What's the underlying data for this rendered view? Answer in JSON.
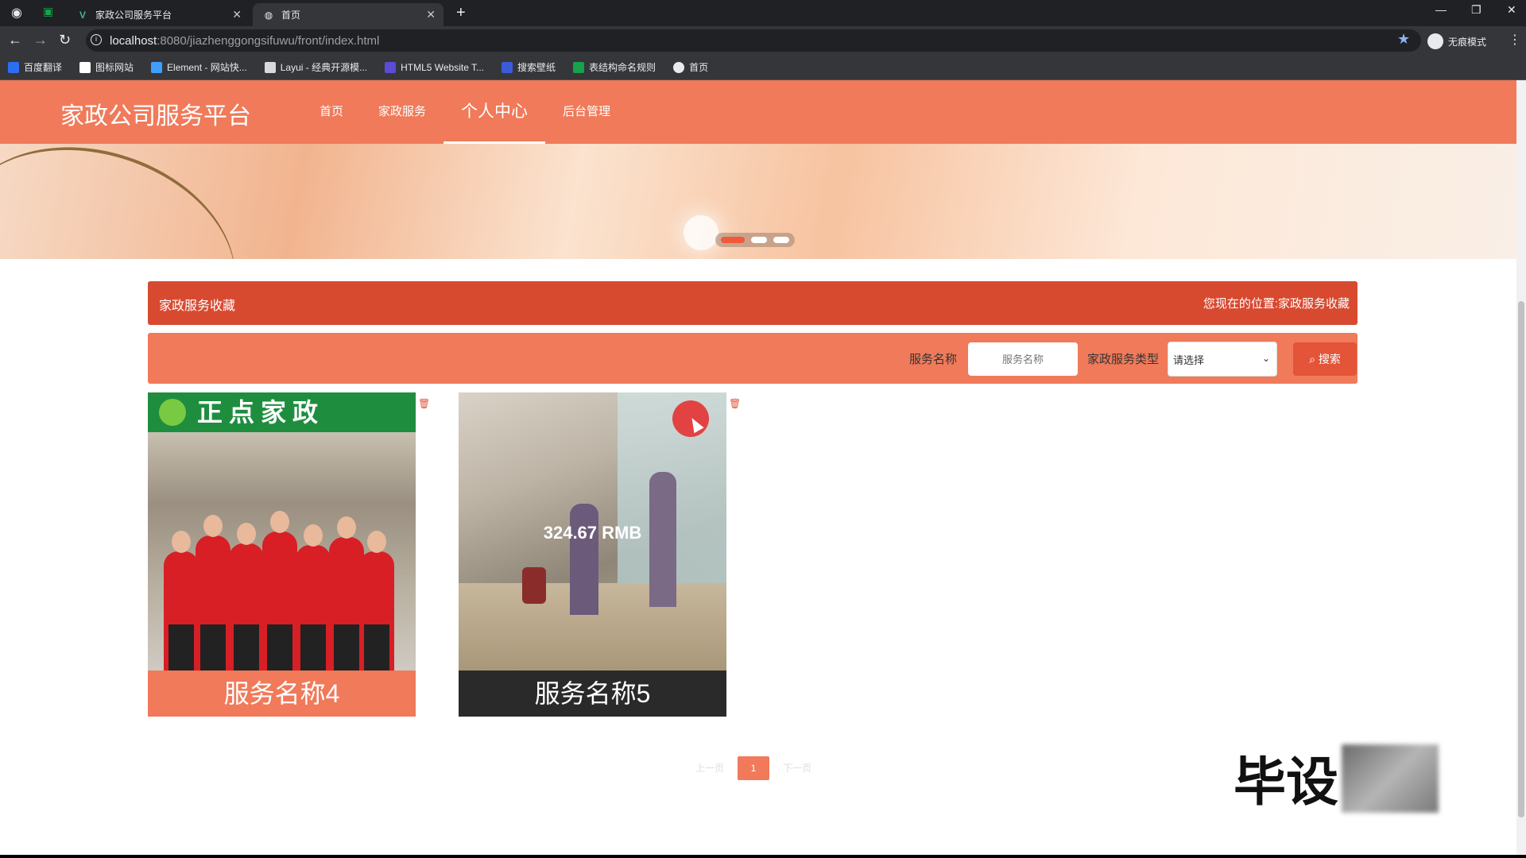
{
  "browser": {
    "tabs": [
      {
        "title": "家政公司服务平台",
        "active": false
      },
      {
        "title": "首页",
        "active": true
      }
    ],
    "new_tab": "+",
    "url_host": "localhost",
    "url_path": ":8080/jiazhenggongsifuwu/front/index.html",
    "profile_label": "无痕模式",
    "bookmarks": [
      {
        "label": "百度翻译",
        "color": "#2c6ef2"
      },
      {
        "label": "图标网站",
        "color": "#ffffff"
      },
      {
        "label": "Element - 网站快...",
        "color": "#409eff"
      },
      {
        "label": "Layui - 经典开源模...",
        "color": "#d9d9d9"
      },
      {
        "label": "HTML5 Website T...",
        "color": "#5b4bd6"
      },
      {
        "label": "搜索壁纸",
        "color": "#3b5bdb"
      },
      {
        "label": "表结构命名规则",
        "color": "#16a34a"
      },
      {
        "label": "首页",
        "color": "#e8eaed"
      }
    ]
  },
  "site": {
    "brand": "家政公司服务平台",
    "nav": [
      {
        "label": "首页",
        "active": false
      },
      {
        "label": "家政服务",
        "active": false
      },
      {
        "label": "个人中心",
        "active": true
      },
      {
        "label": "后台管理",
        "active": false
      }
    ],
    "accent": "#f07a5a",
    "title_bar_color": "#d84a30"
  },
  "section": {
    "title": "家政服务收藏",
    "location_prefix": "您现在的位置:",
    "location": "家政服务收藏"
  },
  "search": {
    "name_label": "服务名称",
    "name_placeholder": "服务名称",
    "type_label": "家政服务类型",
    "type_selected": "请选择",
    "button_label": "搜索"
  },
  "cards": [
    {
      "name": "服务名称4",
      "sign_text": "正点家政"
    },
    {
      "name": "服务名称5",
      "price_overlay": "324.67 RMB"
    }
  ],
  "pager": {
    "prev": "上一页",
    "current": "1",
    "next": "下一页"
  },
  "watermark": "毕设"
}
